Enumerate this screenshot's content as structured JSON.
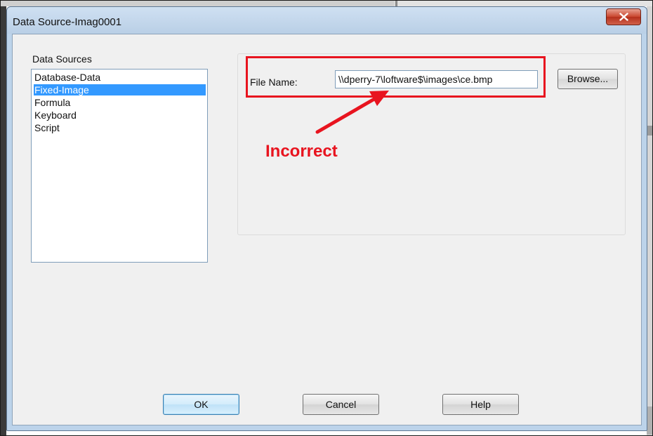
{
  "window": {
    "title": "Data Source-Imag0001"
  },
  "data_sources": {
    "label": "Data Sources",
    "items": [
      {
        "label": "Database-Data",
        "selected": false
      },
      {
        "label": "Fixed-Image",
        "selected": true
      },
      {
        "label": "Formula",
        "selected": false
      },
      {
        "label": "Keyboard",
        "selected": false
      },
      {
        "label": "Script",
        "selected": false
      }
    ]
  },
  "file": {
    "label": "File Name:",
    "value": "\\\\dperry-7\\loftware$\\images\\ce.bmp",
    "browse_label": "Browse..."
  },
  "annotation": {
    "text": "Incorrect",
    "color": "#e8141f"
  },
  "buttons": {
    "ok": "OK",
    "cancel": "Cancel",
    "help": "Help"
  },
  "colors": {
    "selection": "#3399ff",
    "close_button": "#c9452e",
    "highlight": "#e8141f"
  }
}
